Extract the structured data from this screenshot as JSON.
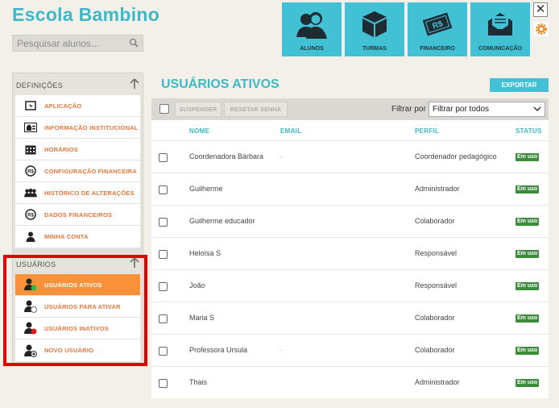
{
  "app": {
    "title": "Escola Bambino"
  },
  "search": {
    "placeholder": "Pesquisar alunos..."
  },
  "tiles": [
    {
      "label": "ALUNOS",
      "icon": "students-icon"
    },
    {
      "label": "TURMAS",
      "icon": "box-icon"
    },
    {
      "label": "FINANCEIRO",
      "icon": "money-icon"
    },
    {
      "label": "COMUNICAÇÃO",
      "icon": "envelope-icon"
    }
  ],
  "definicoes": {
    "heading": "DEFINIÇÕES",
    "items": [
      {
        "label": "APLICAÇÃO",
        "icon": "app-icon"
      },
      {
        "label": "INFORMAÇÃO INSTITUCIONAL",
        "icon": "institution-icon"
      },
      {
        "label": "HORÁRIOS",
        "icon": "calendar-icon"
      },
      {
        "label": "CONFIGURAÇÃO FINANCEIRA",
        "icon": "money-circle-icon"
      },
      {
        "label": "HISTÓRICO DE ALTERAÇÕES",
        "icon": "people-icon"
      },
      {
        "label": "DADOS FINANCEIROS",
        "icon": "money-circle-icon"
      },
      {
        "label": "MINHA CONTA",
        "icon": "user-icon"
      }
    ]
  },
  "usuarios": {
    "heading": "USUÁRIOS",
    "items": [
      {
        "label": "USUÁRIOS ATIVOS",
        "icon": "user-active-icon",
        "active": true
      },
      {
        "label": "USUÁRIOS PARA ATIVAR",
        "icon": "user-pending-icon",
        "active": false
      },
      {
        "label": "USUÁRIOS INATIVOS",
        "icon": "user-inactive-icon",
        "active": false
      },
      {
        "label": "NOVO USUÁRIO",
        "icon": "user-add-icon",
        "active": false
      }
    ]
  },
  "main": {
    "title": "USUÁRIOS ATIVOS",
    "export_label": "EXPORTAR",
    "suspend_label": "SUSPENDER",
    "reset_label": "RESETAR SENHA",
    "filter_label": "Filtrar por",
    "filter_value": "Filtrar por todos",
    "columns": {
      "name": "NOME",
      "email": "EMAIL",
      "profile": "PERFIL",
      "status": "STATUS"
    },
    "rows": [
      {
        "name": "Coordenadora Bárbara",
        "email": "·",
        "profile": "Coordenador pedagógico",
        "status": "Em uso"
      },
      {
        "name": "Guilherme",
        "email": "",
        "profile": "Administrador",
        "status": "Em uso"
      },
      {
        "name": "Guilherme educador",
        "email": "",
        "profile": "Colaborador",
        "status": "Em uso"
      },
      {
        "name": "Heloísa S",
        "email": "",
        "profile": "Responsável",
        "status": "Em uso"
      },
      {
        "name": "João",
        "email": "",
        "profile": "Responsável",
        "status": "Em uso"
      },
      {
        "name": "Maria S",
        "email": "",
        "profile": "Colaborador",
        "status": "Em uso"
      },
      {
        "name": "Professora Ursula",
        "email": "·",
        "profile": "Colaborador",
        "status": "Em uso"
      },
      {
        "name": "Thais",
        "email": "",
        "profile": "Administrador",
        "status": "Em uso"
      }
    ]
  },
  "colors": {
    "accent": "#42c1d4",
    "title": "#3cb8c8",
    "active_item": "#fb923a",
    "status_badge": "#3d8c3d",
    "highlight_frame": "#e10000"
  }
}
